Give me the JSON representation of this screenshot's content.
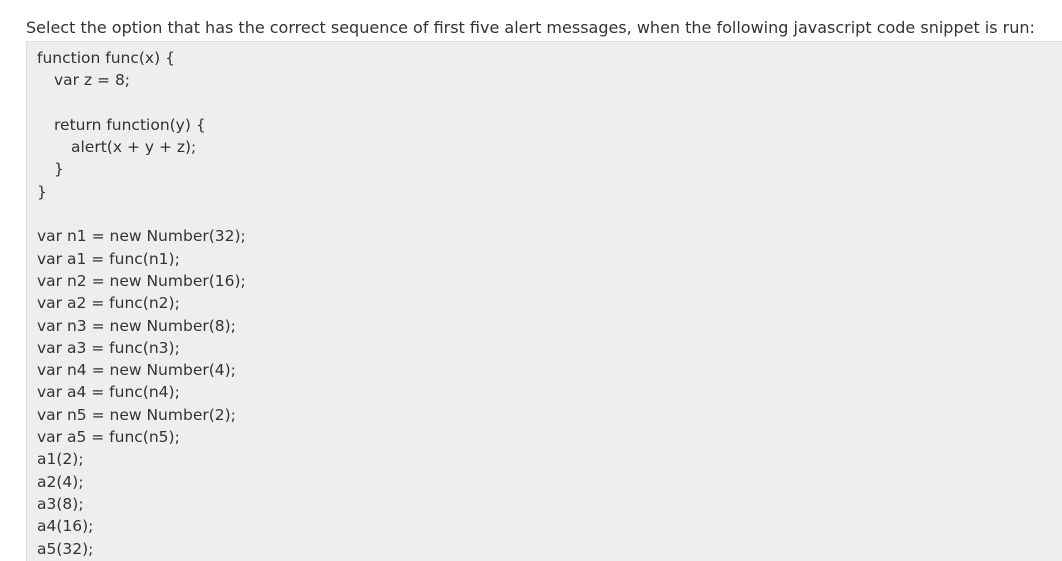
{
  "question": {
    "text": "Select the option that has the correct sequence of first five alert messages, when the following javascript code snippet is run:"
  },
  "code": {
    "lines": [
      {
        "text": "function func(x) {",
        "indent": 10
      },
      {
        "text": "var z = 8;",
        "indent": 27
      },
      {
        "text": "",
        "indent": 0
      },
      {
        "text": "return function(y) {",
        "indent": 27
      },
      {
        "text": "alert(x + y + z);",
        "indent": 44
      },
      {
        "text": "}",
        "indent": 27
      },
      {
        "text": "}",
        "indent": 10
      },
      {
        "text": "",
        "indent": 0
      },
      {
        "text": "var n1 = new Number(32);",
        "indent": 10
      },
      {
        "text": "var a1 = func(n1);",
        "indent": 10
      },
      {
        "text": "var n2 = new Number(16);",
        "indent": 10
      },
      {
        "text": "var a2 = func(n2);",
        "indent": 10
      },
      {
        "text": "var n3 = new Number(8);",
        "indent": 10
      },
      {
        "text": "var a3 = func(n3);",
        "indent": 10
      },
      {
        "text": "var n4 = new Number(4);",
        "indent": 10
      },
      {
        "text": "var a4 = func(n4);",
        "indent": 10
      },
      {
        "text": "var n5 = new Number(2);",
        "indent": 10
      },
      {
        "text": "var a5 = func(n5);",
        "indent": 10
      },
      {
        "text": "a1(2);",
        "indent": 10
      },
      {
        "text": "a2(4);",
        "indent": 10
      },
      {
        "text": "a3(8);",
        "indent": 10
      },
      {
        "text": "a4(16);",
        "indent": 10
      },
      {
        "text": "a5(32);",
        "indent": 10
      }
    ]
  },
  "colors": {
    "text": "#333333",
    "code_background": "#eeeeee",
    "code_border": "#dddddd",
    "page_background": "#ffffff"
  }
}
